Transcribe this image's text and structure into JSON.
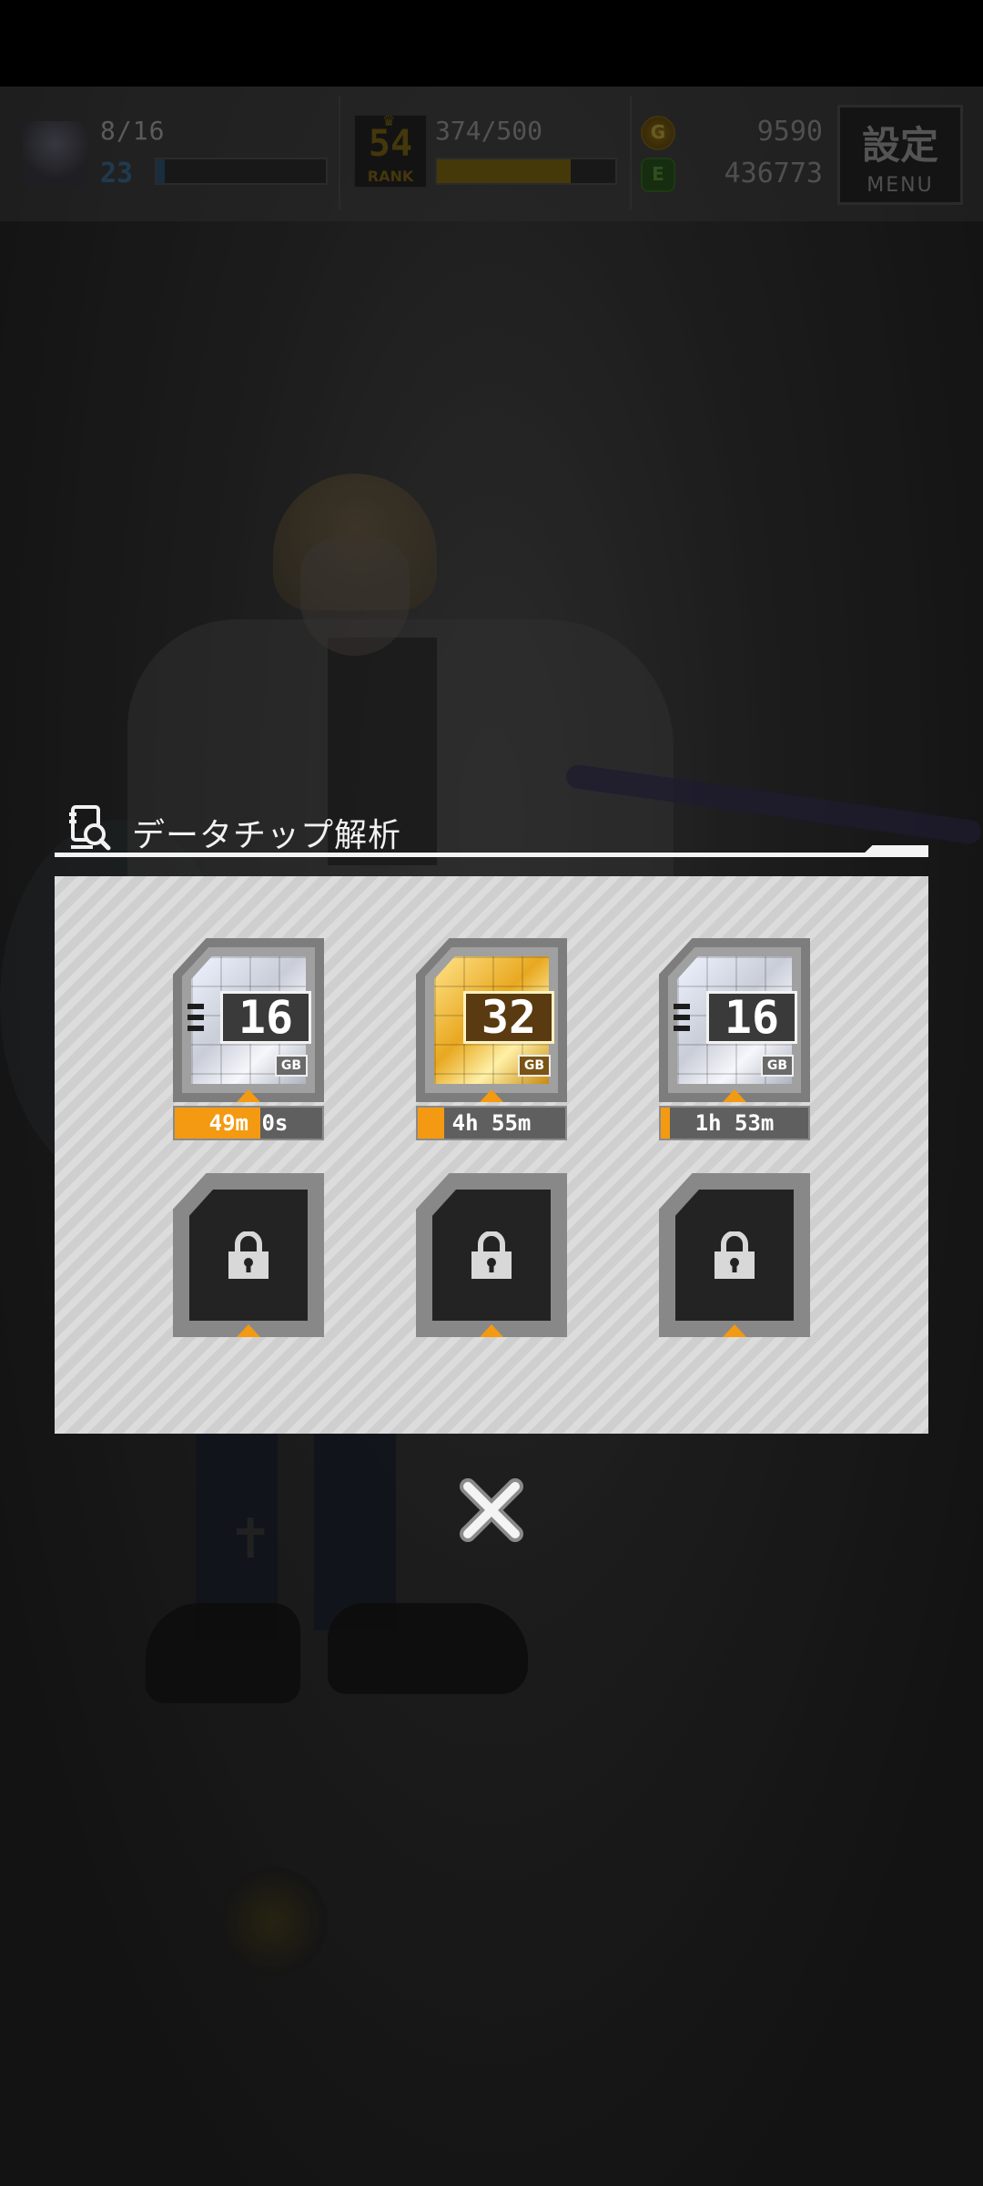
{
  "hud": {
    "stamina": "8/16",
    "level": "23",
    "level_bar_fill": 0.05,
    "rank": {
      "number": "54",
      "label": "RANK"
    },
    "exp": "374/500",
    "exp_bar_fill": 0.75,
    "gold": "9590",
    "gems": "436773",
    "coin_icon_letter": "G",
    "gem_icon_letter": "E",
    "menu": {
      "kanji": "設定",
      "label": "MENU"
    }
  },
  "dialog": {
    "title": "データチップ解析",
    "slots": [
      {
        "chip": "16",
        "unit": "GB",
        "type": "silver",
        "timer": "49m 0s",
        "progress": 0.58
      },
      {
        "chip": "32",
        "unit": "GB",
        "type": "gold",
        "timer": "4h 55m",
        "progress": 0.18
      },
      {
        "chip": "16",
        "unit": "GB",
        "type": "silver",
        "timer": "1h 53m",
        "progress": 0.06
      }
    ],
    "locked_slots": 3
  },
  "colors": {
    "accent_orange": "#f39a12",
    "panel": "#cfcfcf",
    "dialog_line": "#f4f4f4"
  }
}
